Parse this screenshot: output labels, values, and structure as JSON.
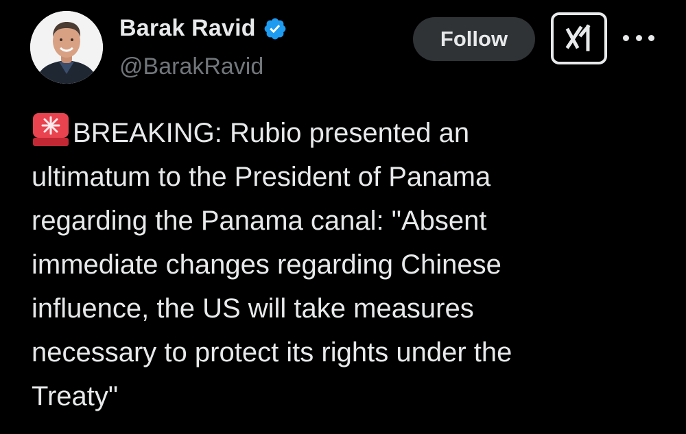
{
  "author": {
    "display_name": "Barak Ravid",
    "handle": "@BarakRavid",
    "verified": true,
    "verified_color": "#1d9bf0"
  },
  "actions": {
    "follow_label": "Follow",
    "grok_icon": "grok-icon",
    "more_icon": "more-options-icon"
  },
  "tweet": {
    "emoji": "siren-icon",
    "lines": [
      "BREAKING: Rubio presented an",
      "ultimatum to the President of Panama",
      "regarding the Panama canal: \"Absent",
      "immediate changes regarding Chinese",
      "influence, the US will take measures",
      "necessary to protect its rights under the",
      "Treaty\""
    ]
  },
  "colors": {
    "background": "#000000",
    "primary_text": "#e7e9ea",
    "secondary_text": "#71767b",
    "follow_bg": "#2f3336"
  }
}
